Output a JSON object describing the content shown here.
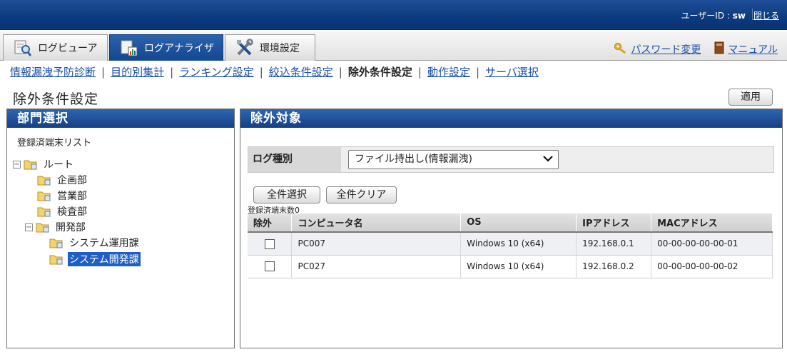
{
  "header": {
    "user_label": "ユーザーID : ",
    "user_id": "sw",
    "close_label": "閉じる"
  },
  "tabs": [
    {
      "label": "ログビューア",
      "icon": "log-viewer-icon"
    },
    {
      "label": "ログアナライザ",
      "icon": "log-analyzer-icon"
    },
    {
      "label": "環境設定",
      "icon": "tools-icon"
    }
  ],
  "right_links": {
    "password": "パスワード変更",
    "manual": "マニュアル"
  },
  "subnav": [
    {
      "label": "情報漏洩予防診断",
      "current": false
    },
    {
      "label": "目的別集計",
      "current": false
    },
    {
      "label": "ランキング設定",
      "current": false
    },
    {
      "label": "絞込条件設定",
      "current": false
    },
    {
      "label": "除外条件設定",
      "current": true
    },
    {
      "label": "動作設定",
      "current": false
    },
    {
      "label": "サーバ選択",
      "current": false
    }
  ],
  "page": {
    "title": "除外条件設定",
    "apply_label": "適用"
  },
  "left_panel": {
    "title": "部門選択",
    "list_title": "登録済端末リスト",
    "tree": [
      {
        "label": "ルート",
        "toggle": "⊟",
        "selected": false
      },
      {
        "label": "企画部",
        "toggle": "",
        "selected": false
      },
      {
        "label": "営業部",
        "toggle": "",
        "selected": false
      },
      {
        "label": "検査部",
        "toggle": "",
        "selected": false
      },
      {
        "label": "開発部",
        "toggle": "⊟",
        "selected": false
      },
      {
        "label": "システム運用課",
        "toggle": "",
        "selected": false
      },
      {
        "label": "システム開発課",
        "toggle": "",
        "selected": true
      }
    ]
  },
  "right_panel": {
    "title": "除外対象",
    "log_type_label": "ログ種別",
    "log_type_value": "ファイル持出し(情報漏洩)",
    "select_all_label": "全件選択",
    "clear_all_label": "全件クリア",
    "registered_count_label": "登録済端末数0",
    "table": {
      "headers": [
        "除外",
        "コンピュータ名",
        "OS",
        "IPアドレス",
        "MACアドレス"
      ],
      "rows": [
        {
          "checked": false,
          "computer": "PC007",
          "os": "Windows 10 (x64)",
          "ip": "192.168.0.1",
          "mac": "00-00-00-00-00-01"
        },
        {
          "checked": false,
          "computer": "PC027",
          "os": "Windows 10 (x64)",
          "ip": "192.168.0.2",
          "mac": "00-00-00-00-00-02"
        }
      ]
    }
  },
  "colors": {
    "header_blue": "#0c3a7e",
    "active_tab": "#1d5ba8",
    "link": "#1a4fa8",
    "selection": "#1d5ec7"
  }
}
